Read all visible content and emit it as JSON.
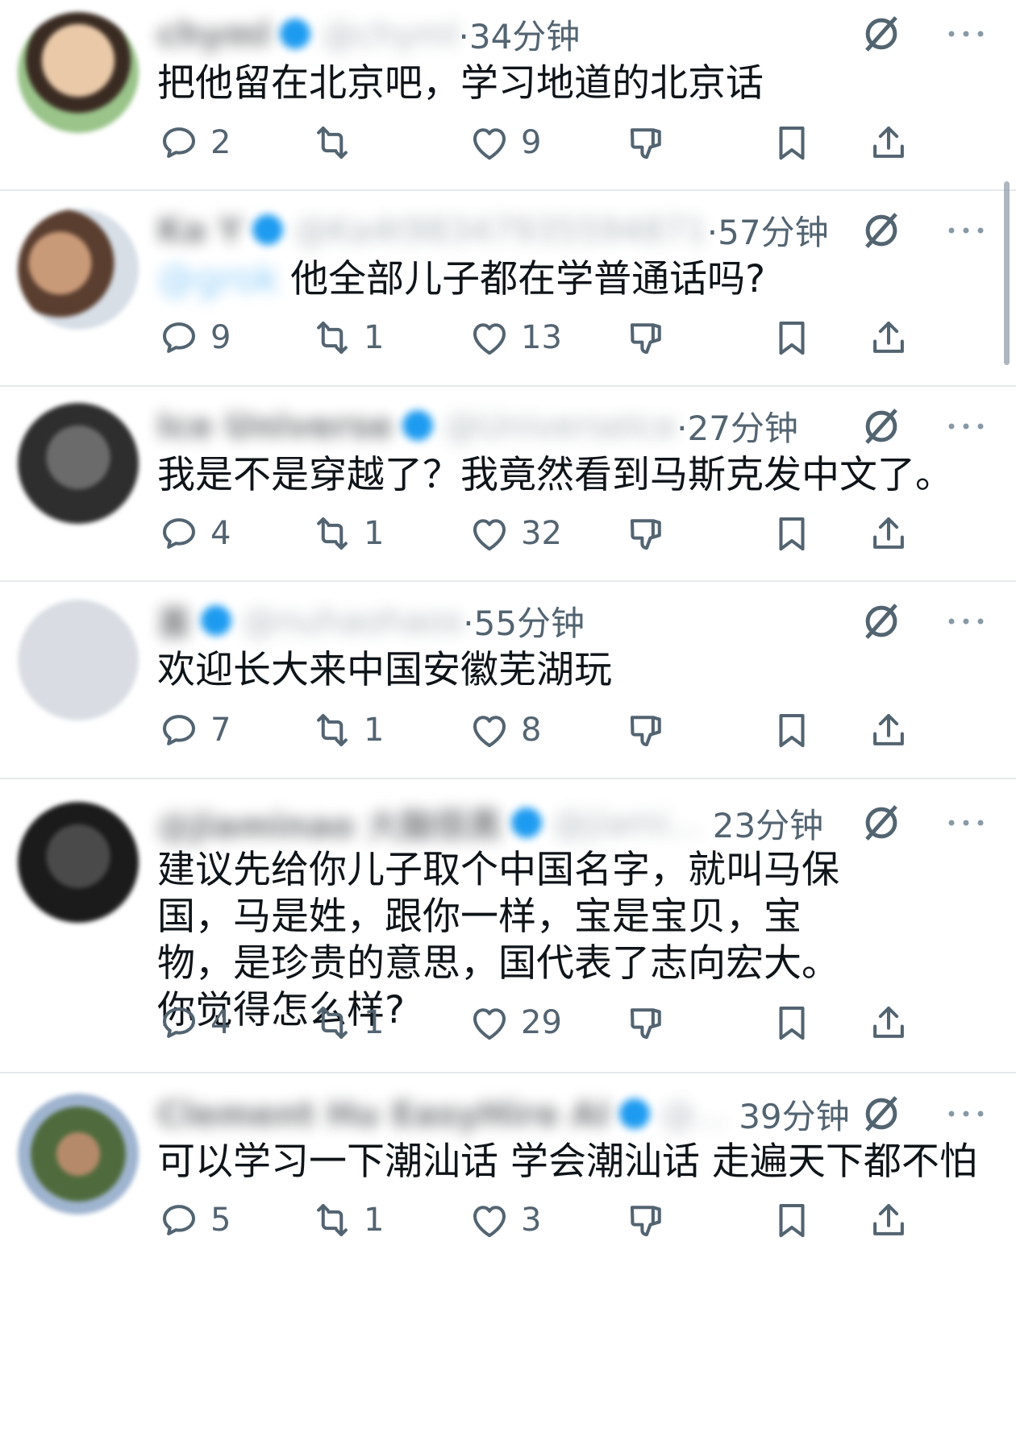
{
  "tweets": [
    {
      "name": "chyml",
      "handle": "@chyml",
      "time": "·34分钟",
      "mention": "",
      "text": "把他留在北京吧，学习地道的北京话",
      "replies": "2",
      "reposts": "",
      "likes": "9"
    },
    {
      "name": "Ka Y",
      "handle": "@Ka4t98347935594871",
      "time": "·57分钟",
      "mention": "@grok",
      "text": "他全部儿子都在学普通话吗?",
      "replies": "9",
      "reposts": "1",
      "likes": "13"
    },
    {
      "name": "Ice Universe",
      "handle": "@UniverseIce",
      "time": "·27分钟",
      "mention": "",
      "text": "我是不是穿越了？我竟然看到马斯克发中文了。",
      "replies": "4",
      "reposts": "1",
      "likes": "32"
    },
    {
      "name": "喜",
      "handle": "@nuhaohaos",
      "time": "·55分钟",
      "mention": "",
      "text": "欢迎长大来中国安徽芜湖玩",
      "replies": "7",
      "reposts": "1",
      "likes": "8"
    },
    {
      "name": "@jiaminao 大脑很黑",
      "handle": "@jiami...",
      "time": "23分钟",
      "mention": "",
      "text": "建议先给你儿子取个中国名字，就叫马保国，马是姓，跟你一样，宝是宝贝，宝物，是珍贵的意思，国代表了志向宏大。你觉得怎么样?",
      "replies": "4",
      "reposts": "1",
      "likes": "29"
    },
    {
      "name": "Clement Hu EasyHire AI",
      "handle": "@...",
      "time": "39分钟",
      "mention": "",
      "text": "可以学习一下潮汕话 学会潮汕话 走遍天下都不怕",
      "replies": "5",
      "reposts": "1",
      "likes": "3"
    }
  ],
  "icons": {
    "reply": "speech-bubble-icon",
    "repost": "repost-arrows-icon",
    "like": "heart-icon",
    "grok": "grok-slash-icon",
    "more": "ellipsis-icon",
    "dislike": "thumb-down-icon",
    "bookmark": "bookmark-icon",
    "share": "share-upload-icon"
  },
  "colors": {
    "text": "#0f1419",
    "secondary": "#536471",
    "accent": "#1d9bf0",
    "divider": "#e6e9ec"
  }
}
